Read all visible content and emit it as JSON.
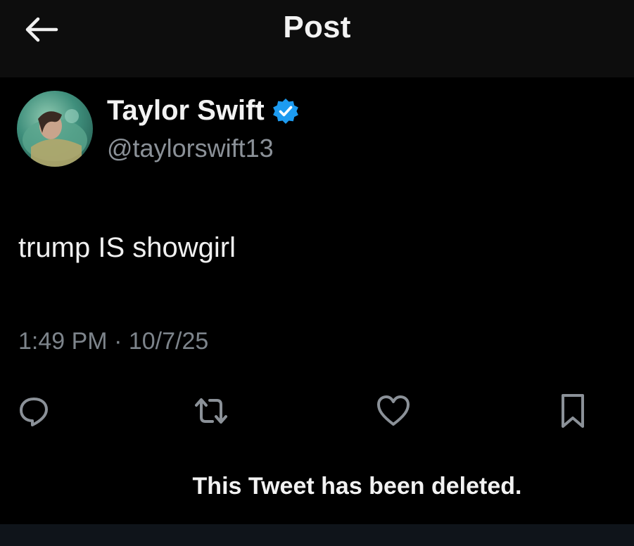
{
  "header": {
    "title": "Post",
    "back_icon": "arrow-left-icon"
  },
  "post": {
    "author_name": "Taylor Swift",
    "author_handle": "@taylorswift13",
    "verified_badge": "verified-check-icon",
    "text": "trump IS showgirl",
    "meta": "1:49 PM · 10/7/25"
  },
  "actions": [
    {
      "icon": "reply-icon"
    },
    {
      "icon": "retweet-icon"
    },
    {
      "icon": "like-icon"
    },
    {
      "icon": "bookmark-icon"
    }
  ],
  "overlay": {
    "caption": "This Tweet has been deleted."
  },
  "colors": {
    "background": "#000000",
    "header_bg": "#0d0d0d",
    "text_primary": "#e7e9ea",
    "text_secondary": "#8b9198",
    "verified_blue": "#1d9bf0"
  }
}
